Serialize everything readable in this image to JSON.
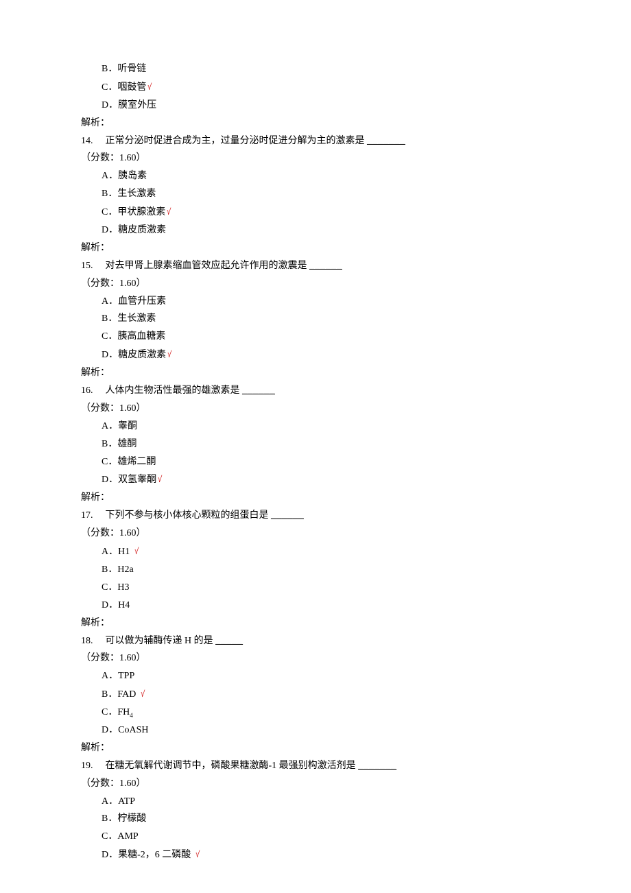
{
  "options_pre": [
    {
      "label": "B．",
      "text": "听骨链",
      "correct": false
    },
    {
      "label": "C．",
      "text": "咽鼓管",
      "correct": true
    },
    {
      "label": "D．",
      "text": "膜室外压",
      "correct": false
    }
  ],
  "analysis_label": "解析：",
  "points_prefix": "（分数：",
  "points_value": "1.60",
  "points_suffix": "）",
  "questions": [
    {
      "num": "14.",
      "stem": "正常分泌时促进合成为主，过量分泌时促进分解为主的激素是 ",
      "blank": "_______",
      "options": [
        {
          "label": "A．",
          "text": "胰岛素",
          "correct": false
        },
        {
          "label": "B．",
          "text": "生长激素",
          "correct": false
        },
        {
          "label": "C．",
          "text": "甲状腺激素",
          "correct": true
        },
        {
          "label": "D．",
          "text": "糖皮质激素",
          "correct": false
        }
      ]
    },
    {
      "num": "15.",
      "stem": "对去甲肾上腺素缩血管效应起允许作用的激震是 ",
      "blank": "______",
      "options": [
        {
          "label": "A．",
          "text": "血管升压素",
          "correct": false
        },
        {
          "label": "B．",
          "text": "生长激素",
          "correct": false
        },
        {
          "label": "C．",
          "text": "胰高血糖素",
          "correct": false
        },
        {
          "label": "D．",
          "text": "糖皮质激素",
          "correct": true
        }
      ]
    },
    {
      "num": "16.",
      "stem": "人体内生物活性最强的雄激素是 ",
      "blank": "______",
      "options": [
        {
          "label": "A．",
          "text": "睾酮",
          "correct": false
        },
        {
          "label": "B．",
          "text": "雄酮",
          "correct": false
        },
        {
          "label": "C．",
          "text": "雄烯二酮",
          "correct": false
        },
        {
          "label": "D．",
          "text": "双氢睾酮",
          "correct": true
        }
      ]
    },
    {
      "num": "17.",
      "stem": "下列不参与核小体核心颗粒的组蛋白是 ",
      "blank": "______",
      "options": [
        {
          "label": "A．",
          "text": "H1",
          "correct": true,
          "check_spaced": true
        },
        {
          "label": "B．",
          "text": "H2a",
          "correct": false
        },
        {
          "label": "C．",
          "text": "H3",
          "correct": false
        },
        {
          "label": "D．",
          "text": "H4",
          "correct": false
        }
      ]
    },
    {
      "num": "18.",
      "stem": "可以做为辅酶传递 H 的是 ",
      "blank": "_____",
      "options": [
        {
          "label": "A．",
          "text": "TPP",
          "correct": false
        },
        {
          "label": "B．",
          "text": "FAD",
          "correct": true,
          "check_spaced": true
        },
        {
          "label": "C．",
          "text": "FH",
          "correct": false,
          "sub": "4"
        },
        {
          "label": "D．",
          "text": "CoASH",
          "correct": false
        }
      ]
    },
    {
      "num": "19.",
      "stem": "在糖无氧解代谢调节中，磷酸果糖激酶-1 最强别构激活剂是 ",
      "blank": "_______",
      "options": [
        {
          "label": "A．",
          "text": "ATP",
          "correct": false
        },
        {
          "label": "B．",
          "text": "柠檬酸",
          "correct": false
        },
        {
          "label": "C．",
          "text": "AMP",
          "correct": false
        },
        {
          "label": "D．",
          "text": "果糖-2，6 二磷酸",
          "correct": true,
          "check_spaced": true
        }
      ],
      "no_analysis": true
    }
  ]
}
